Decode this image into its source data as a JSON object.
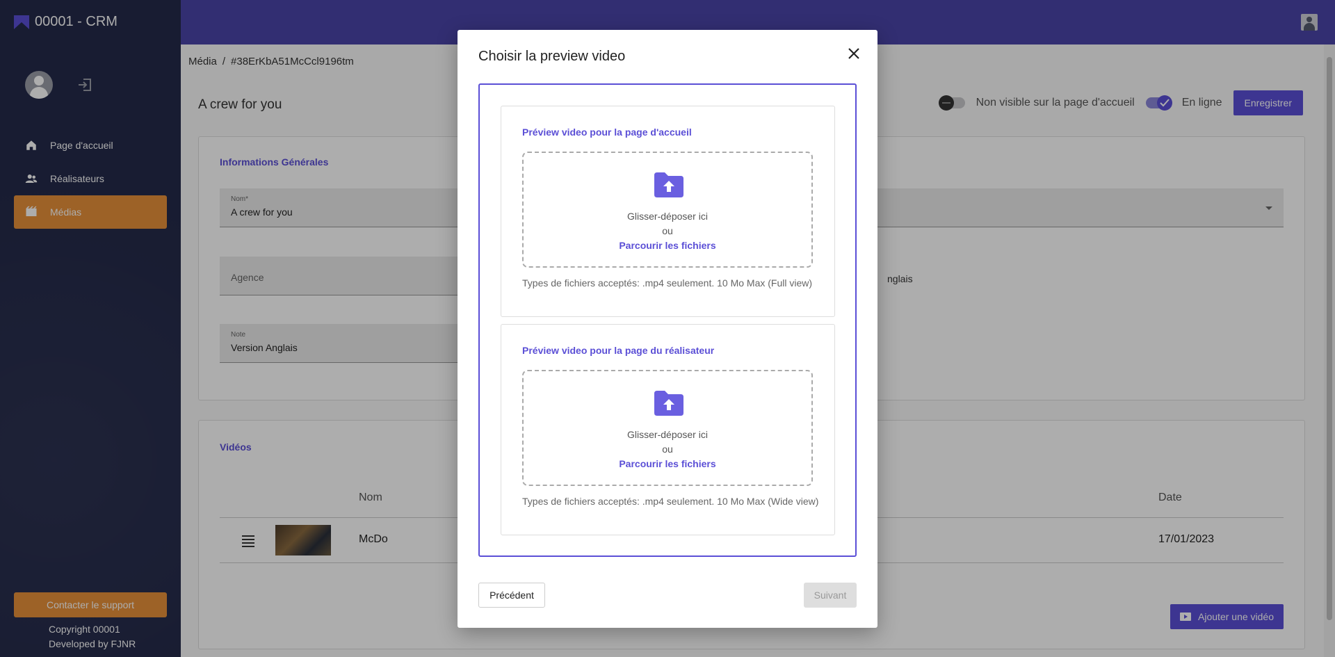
{
  "app": {
    "title": "00001 - CRM"
  },
  "sidebar": {
    "items": [
      {
        "label": "Page d'accueil",
        "icon": "home-icon"
      },
      {
        "label": "Réalisateurs",
        "icon": "people-icon"
      },
      {
        "label": "Médias",
        "icon": "film-icon",
        "active": true
      }
    ],
    "support_label": "Contacter le support",
    "copyright_line1": "Copyright 00001",
    "copyright_line2": "Developed by FJNR"
  },
  "breadcrumb": {
    "section": "Média",
    "separator": "/",
    "id": "#38ErKbA51McCcl9196tm"
  },
  "page": {
    "title": "A crew for you",
    "visibility_label": "Non visible sur la page d'accueil",
    "online_label": "En ligne",
    "save_label": "Enregistrer"
  },
  "general": {
    "title": "Informations Générales",
    "name_label": "Nom*",
    "name_value": "A crew for you",
    "agency_placeholder": "Agence",
    "note_label": "Note",
    "note_value": "Version Anglais",
    "partial_value": "nglais"
  },
  "videos": {
    "title": "Vidéos",
    "col_name": "Nom",
    "col_date": "Date",
    "rows": [
      {
        "name": "McDo",
        "date": "17/01/2023"
      }
    ],
    "add_label": "Ajouter une vidéo"
  },
  "modal": {
    "title": "Choisir la preview video",
    "uploads": [
      {
        "title": "Préview video pour la page d'accueil",
        "drop_text": "Glisser-déposer ici",
        "or_text": "ou",
        "browse_text": "Parcourir les fichiers",
        "hint": "Types de fichiers acceptés: .mp4 seulement. 10 Mo Max (Full view)"
      },
      {
        "title": "Préview video pour la page du réalisateur",
        "drop_text": "Glisser-déposer ici",
        "or_text": "ou",
        "browse_text": "Parcourir les fichiers",
        "hint": "Types de fichiers acceptés: .mp4 seulement. 10 Mo Max (Wide view)"
      }
    ],
    "prev_label": "Précédent",
    "next_label": "Suivant"
  },
  "colors": {
    "accent": "#5b4fd6",
    "sidebar": "#242a4a",
    "active": "#e8913a",
    "topbar": "#4b45a8"
  }
}
